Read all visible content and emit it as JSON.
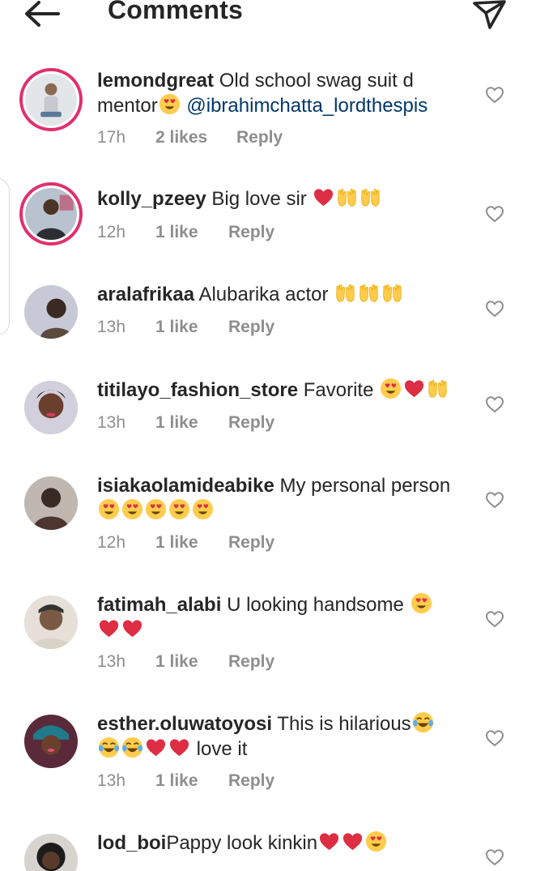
{
  "header": {
    "title": "Comments"
  },
  "comments": [
    {
      "user": "lemondgreat",
      "text": "Old school swag suit d mentor",
      "emoji_after": [
        "heart-eyes"
      ],
      "mention": "@ibrahimchatta_lordthespis",
      "time": "17h",
      "likes": "2 likes",
      "reply": "Reply"
    },
    {
      "user": "kolly_pzeey",
      "text": "Big love sir",
      "emoji_after": [
        "red-heart",
        "raised-hands",
        "raised-hands"
      ],
      "time": "12h",
      "likes": "1 like",
      "reply": "Reply"
    },
    {
      "user": "aralafrikaa",
      "text": "Alubarika actor",
      "emoji_after": [
        "raised-hands",
        "raised-hands",
        "raised-hands"
      ],
      "time": "13h",
      "likes": "1 like",
      "reply": "Reply"
    },
    {
      "user": "titilayo_fashion_store",
      "text": "Favorite",
      "emoji_after": [
        "heart-eyes",
        "red-heart",
        "raised-hands"
      ],
      "time": "13h",
      "likes": "1 like",
      "reply": "Reply"
    },
    {
      "user": "isiakaolamideabike",
      "text": "My personal person",
      "emoji_after": [
        "heart-eyes",
        "heart-eyes",
        "heart-eyes",
        "heart-eyes",
        "heart-eyes"
      ],
      "time": "12h",
      "likes": "1 like",
      "reply": "Reply"
    },
    {
      "user": "fatimah_alabi",
      "text": "U looking handsome",
      "emoji_after": [
        "heart-eyes",
        "red-heart",
        "red-heart"
      ],
      "time": "13h",
      "likes": "1 like",
      "reply": "Reply"
    },
    {
      "user": "esther.oluwatoyosi",
      "text": "This is hilarious",
      "emoji_after": [
        "tears-of-joy",
        "tears-of-joy",
        "tears-of-joy",
        "red-heart",
        "red-heart"
      ],
      "text_after": "love it",
      "time": "13h",
      "likes": "1 like",
      "reply": "Reply"
    },
    {
      "user": "lod_boi",
      "text": "Pappy look kinkin",
      "emoji_after": [
        "red-heart",
        "red-heart",
        "heart-eyes"
      ]
    }
  ],
  "icons": {
    "back": "arrow-left-icon",
    "send": "paper-plane-icon",
    "like": "heart-outline-icon"
  },
  "colors": {
    "text": "#262626",
    "secondary": "#8e8e8e",
    "mention": "#00376b",
    "story_ring": "#e1306c"
  }
}
